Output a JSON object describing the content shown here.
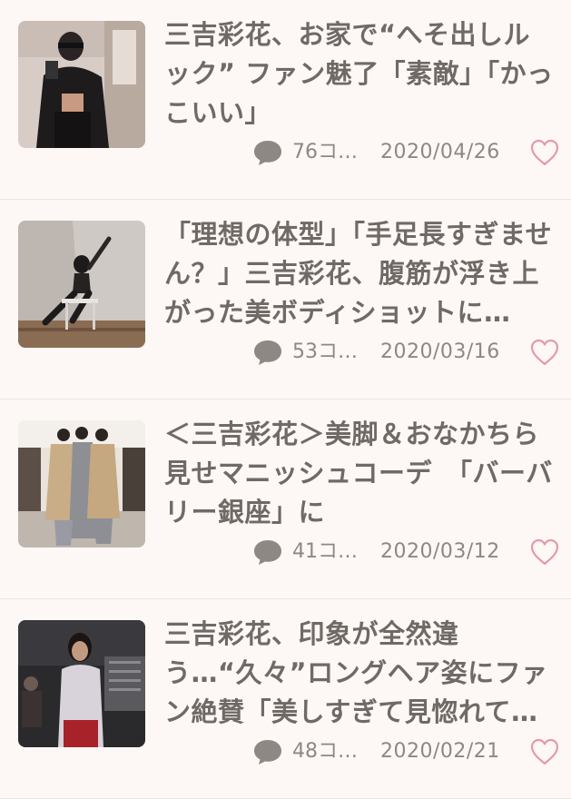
{
  "colors": {
    "background": "#fdf8f5",
    "text": "#6f6a66",
    "meta": "#8d8884",
    "heart": "#e59aa8",
    "comment_icon": "#8d8884"
  },
  "articles": [
    {
      "title": "三吉彩花、お家で“へそ出しルック” ファン魅了「素敵」「かっこいい」",
      "comments": "76コ…",
      "date": "2020/04/26",
      "comment_icon": "speech-bubble-icon",
      "like_icon": "heart-outline-icon"
    },
    {
      "title": "「理想の体型」「手足長すぎません？」三吉彩花、腹筋が浮き上がった美ボディショットに…",
      "comments": "53コ…",
      "date": "2020/03/16",
      "comment_icon": "speech-bubble-icon",
      "like_icon": "heart-outline-icon"
    },
    {
      "title": "＜三吉彩花＞美脚＆おなかちら見せマニッシュコーデ　「バーバリー銀座」に",
      "comments": "41コ…",
      "date": "2020/03/12",
      "comment_icon": "speech-bubble-icon",
      "like_icon": "heart-outline-icon"
    },
    {
      "title": "三吉彩花、印象が全然違う…“久々”ロングヘア姿にファン絶賛「美しすぎて見惚れて…",
      "comments": "48コ…",
      "date": "2020/02/21",
      "comment_icon": "speech-bubble-icon",
      "like_icon": "heart-outline-icon"
    }
  ]
}
